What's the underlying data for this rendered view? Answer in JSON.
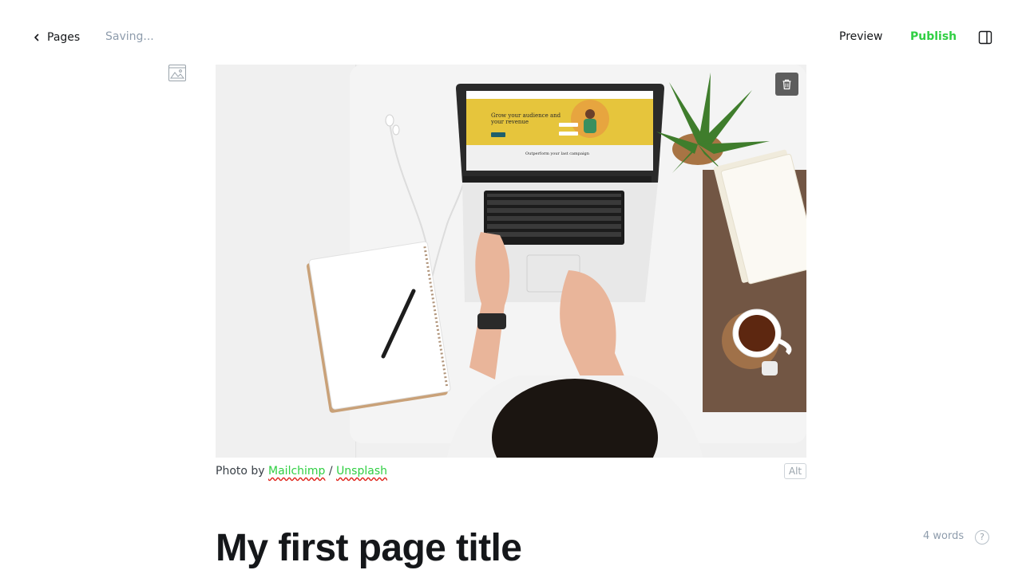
{
  "header": {
    "back_label": "Pages",
    "status": "Saving...",
    "preview_label": "Preview",
    "publish_label": "Publish"
  },
  "feature_image": {
    "caption_prefix": "Photo by",
    "author": "Mailchimp",
    "separator": "/",
    "source": "Unsplash",
    "alt_label": "Alt"
  },
  "screen_in_photo": {
    "headline_1": "Grow your audience and",
    "headline_2": "your revenue",
    "subhead": "Outperform your last campaign"
  },
  "editor": {
    "title": "My first page title",
    "word_count": "4 words",
    "help_label": "?"
  },
  "colors": {
    "accent": "#30cf43",
    "text": "#15171a",
    "muted": "#8e9cac"
  }
}
